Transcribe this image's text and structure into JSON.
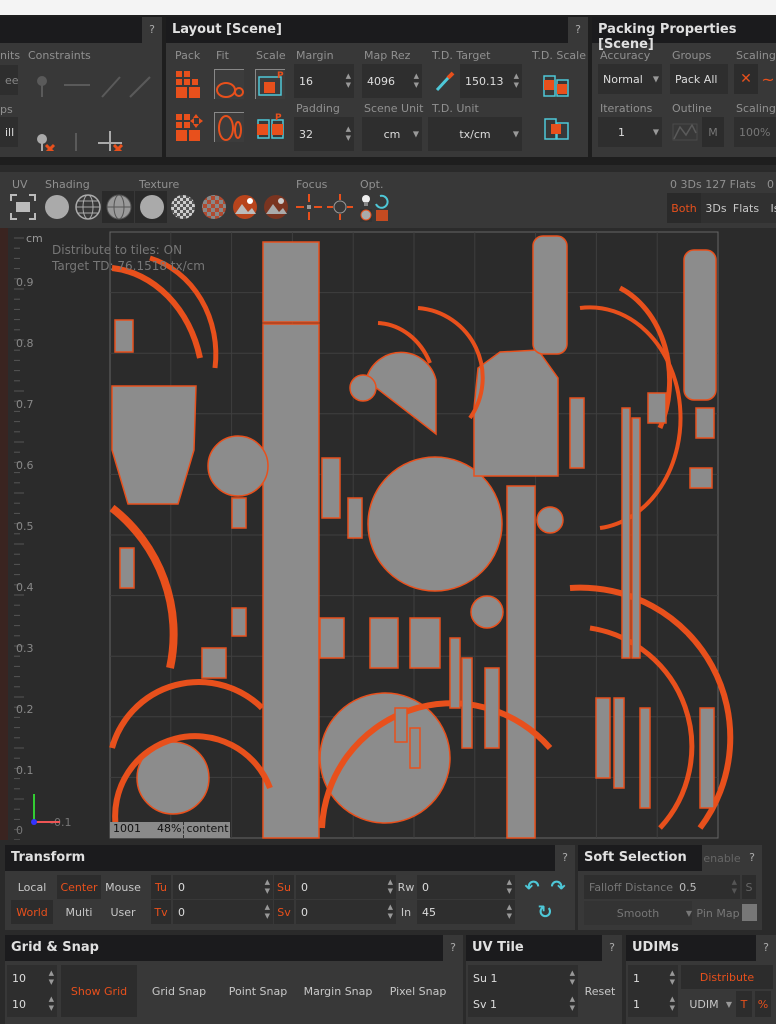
{
  "constraints_panel": {
    "units_label": "nits",
    "units_value": "ee",
    "constraints_label": "Constraints",
    "maps_label": "ps",
    "maps_value": "ill",
    "help": "?"
  },
  "layout_panel": {
    "title": "Layout [Scene]",
    "help": "?",
    "pack_label": "Pack",
    "fit_label": "Fit",
    "scale_label": "Scale",
    "margin_label": "Margin",
    "margin_value": "16",
    "padding_label": "Padding",
    "padding_value": "32",
    "map_rez_label": "Map Rez",
    "map_rez_value": "4096",
    "scene_unit_label": "Scene Unit",
    "scene_unit_value": "cm",
    "td_target_label": "T.D. Target",
    "td_target_value": "150.13",
    "td_unit_label": "T.D. Unit",
    "td_unit_value": "tx/cm",
    "td_scale_label": "T.D. Scale"
  },
  "packing_panel": {
    "title": "Packing Properties [Scene]",
    "accuracy_label": "Accuracy",
    "accuracy_value": "Normal",
    "groups_label": "Groups",
    "groups_value": "Pack All",
    "scaling_label": "Scaling",
    "iterations_label": "Iterations",
    "iterations_value": "1",
    "outline_label": "Outline",
    "outline_m": "M",
    "scaling2_label": "Scaling",
    "scaling2_value": "100%"
  },
  "viewport_toolbar": {
    "uv_label": "UV",
    "shading_label": "Shading",
    "texture_label": "Texture",
    "focus_label": "Focus",
    "opt_label": "Opt.",
    "counts": "0 3Ds 127 Flats",
    "counts2": "0",
    "filter": [
      "Both",
      "3Ds",
      "Flats",
      "Is"
    ],
    "filter_active": "Both"
  },
  "viewport": {
    "unit": "cm",
    "overlay_line1": "Distribute to tiles: ON",
    "overlay_line2": "Target TD: 76.1518 tx/cm",
    "y_ticks": [
      "0.9",
      "0.8",
      "0.7",
      "0.6",
      "0.5",
      "0.4",
      "0.3",
      "0.2",
      "0.1"
    ],
    "x_ticks": [
      "-0.1",
      "0"
    ],
    "tile_id": "1001",
    "content_percent": "48%",
    "content_label": "content",
    "colors": {
      "island_fill": "#8c8c8c",
      "island_edge": "#e8501c",
      "background": "#2b2b2b"
    }
  },
  "transform": {
    "title": "Transform",
    "help": "?",
    "local": "Local",
    "center": "Center",
    "mouse": "Mouse",
    "world": "World",
    "multi": "Multi",
    "user": "User",
    "tu_label": "Tu",
    "tu_value": "0",
    "tv_label": "Tv",
    "tv_value": "0",
    "su_label": "Su",
    "su_value": "0",
    "sv_label": "Sv",
    "sv_value": "0",
    "rw_label": "Rw",
    "rw_value": "0",
    "in_label": "In",
    "in_value": "45"
  },
  "soft_selection": {
    "title": "Soft Selection",
    "enable": "enable",
    "help": "?",
    "falloff_label": "Falloff Distance",
    "falloff_value": "0.5",
    "s_button": "S",
    "smooth": "Smooth",
    "pin_map": "Pin Map"
  },
  "grid_snap": {
    "title": "Grid & Snap",
    "help": "?",
    "grid_u": "10",
    "grid_v": "10",
    "show_grid": "Show Grid",
    "grid_snap": "Grid Snap",
    "point_snap": "Point Snap",
    "margin_snap": "Margin Snap",
    "pixel_snap": "Pixel Snap"
  },
  "uv_tile": {
    "title": "UV Tile",
    "help": "?",
    "su_label": "Su",
    "su_value": "1",
    "sv_label": "Sv",
    "sv_value": "1",
    "reset": "Reset"
  },
  "udims": {
    "title": "UDIMs",
    "help": "?",
    "value1": "1",
    "value2": "1",
    "distribute": "Distribute",
    "mode": "UDIM",
    "t": "T",
    "percent": "%"
  }
}
